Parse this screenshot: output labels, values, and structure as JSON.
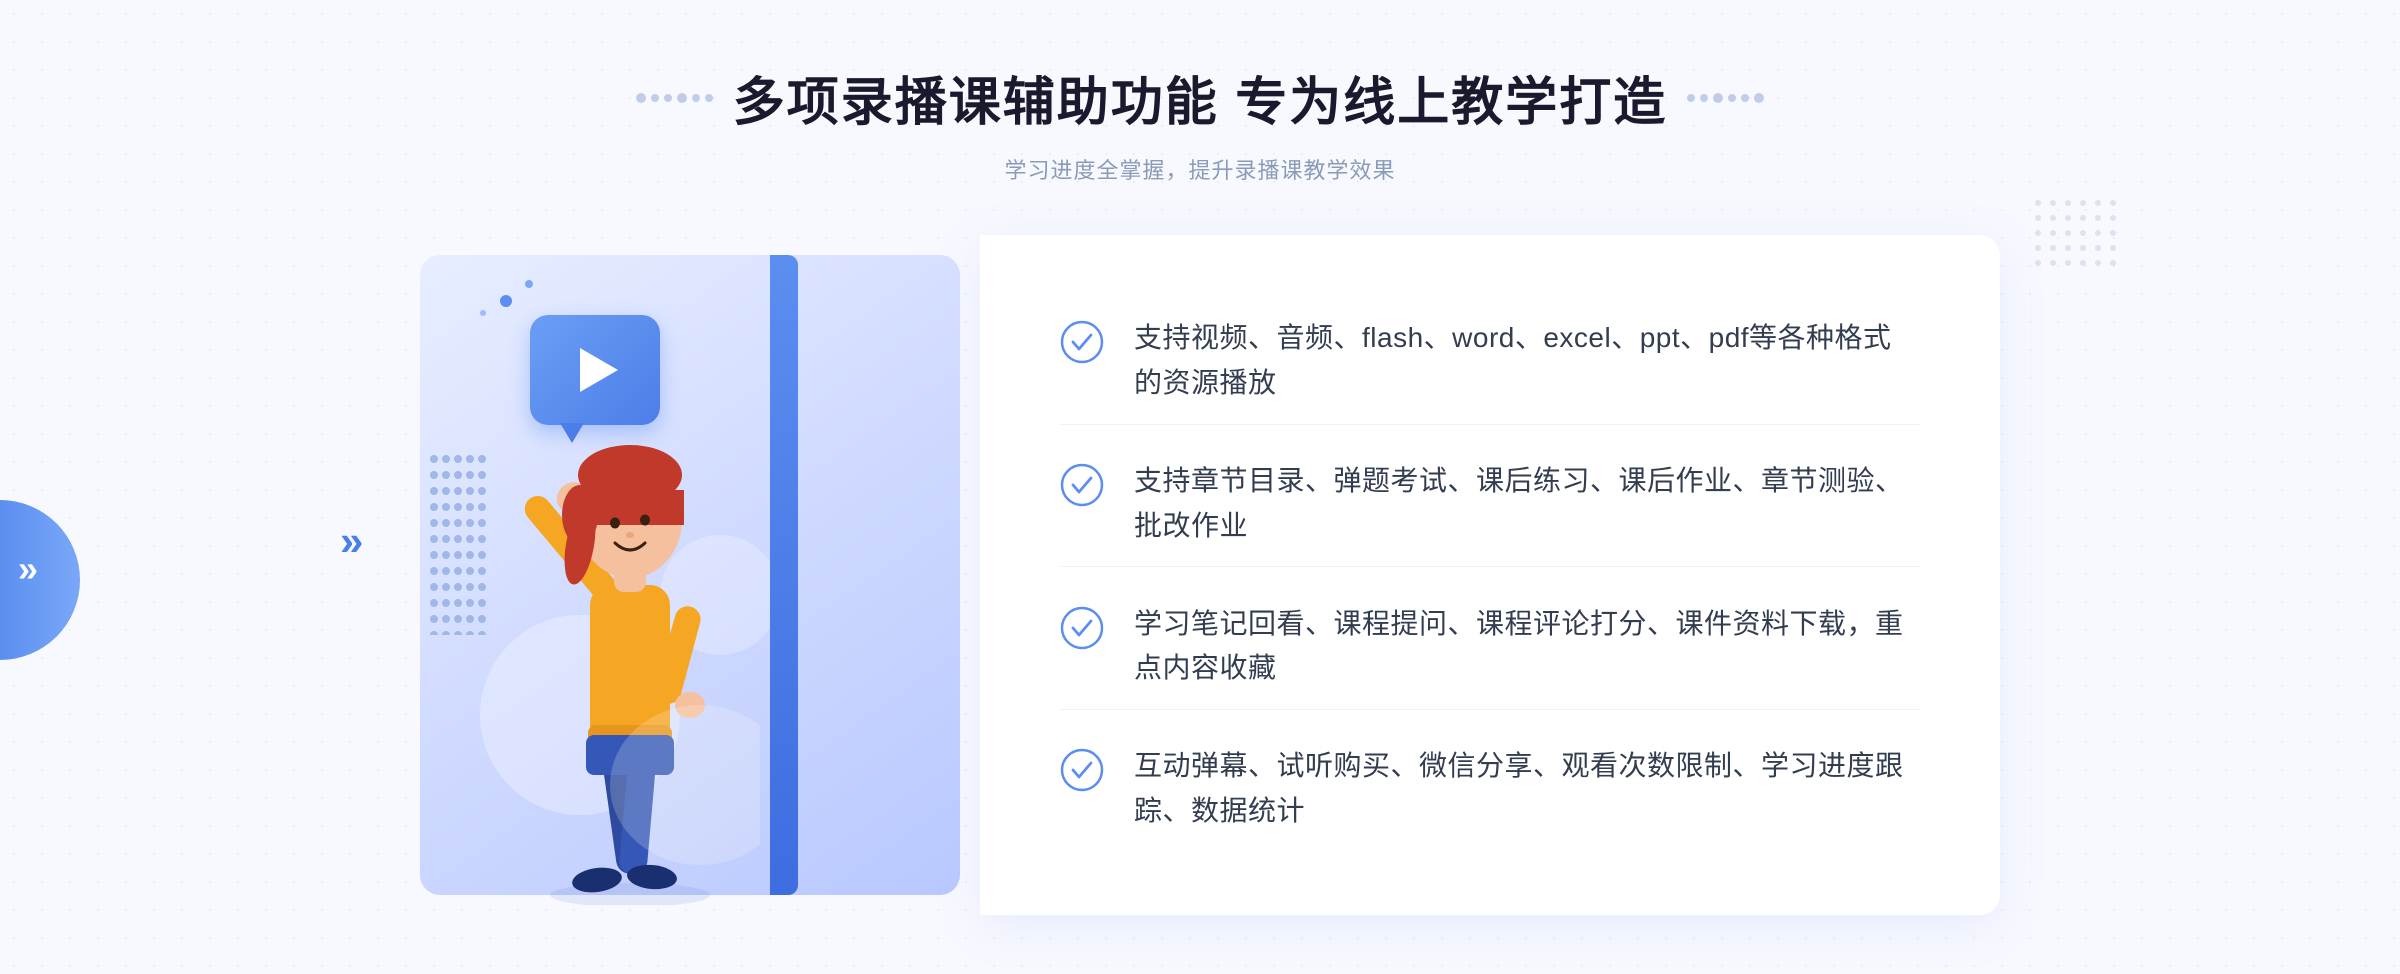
{
  "header": {
    "title": "多项录播课辅助功能 专为线上教学打造",
    "subtitle": "学习进度全掌握，提升录播课教学效果",
    "title_dots_left": "decorative dots left",
    "title_dots_right": "decorative dots right"
  },
  "features": [
    {
      "id": 1,
      "text": "支持视频、音频、flash、word、excel、ppt、pdf等各种格式的资源播放"
    },
    {
      "id": 2,
      "text": "支持章节目录、弹题考试、课后练习、课后作业、章节测验、批改作业"
    },
    {
      "id": 3,
      "text": "学习笔记回看、课程提问、课程评论打分、课件资料下载，重点内容收藏"
    },
    {
      "id": 4,
      "text": "互动弹幕、试听购买、微信分享、观看次数限制、学习进度跟踪、数据统计"
    }
  ],
  "colors": {
    "primary_blue": "#4d7de8",
    "light_blue": "#7aa8f8",
    "bg_light": "#f0f4ff",
    "text_dark": "#333d50",
    "text_light": "#8a9bb8",
    "check_color": "#5b8ef0"
  },
  "icons": {
    "play": "▶",
    "check": "circle-check",
    "chevron": "»"
  }
}
